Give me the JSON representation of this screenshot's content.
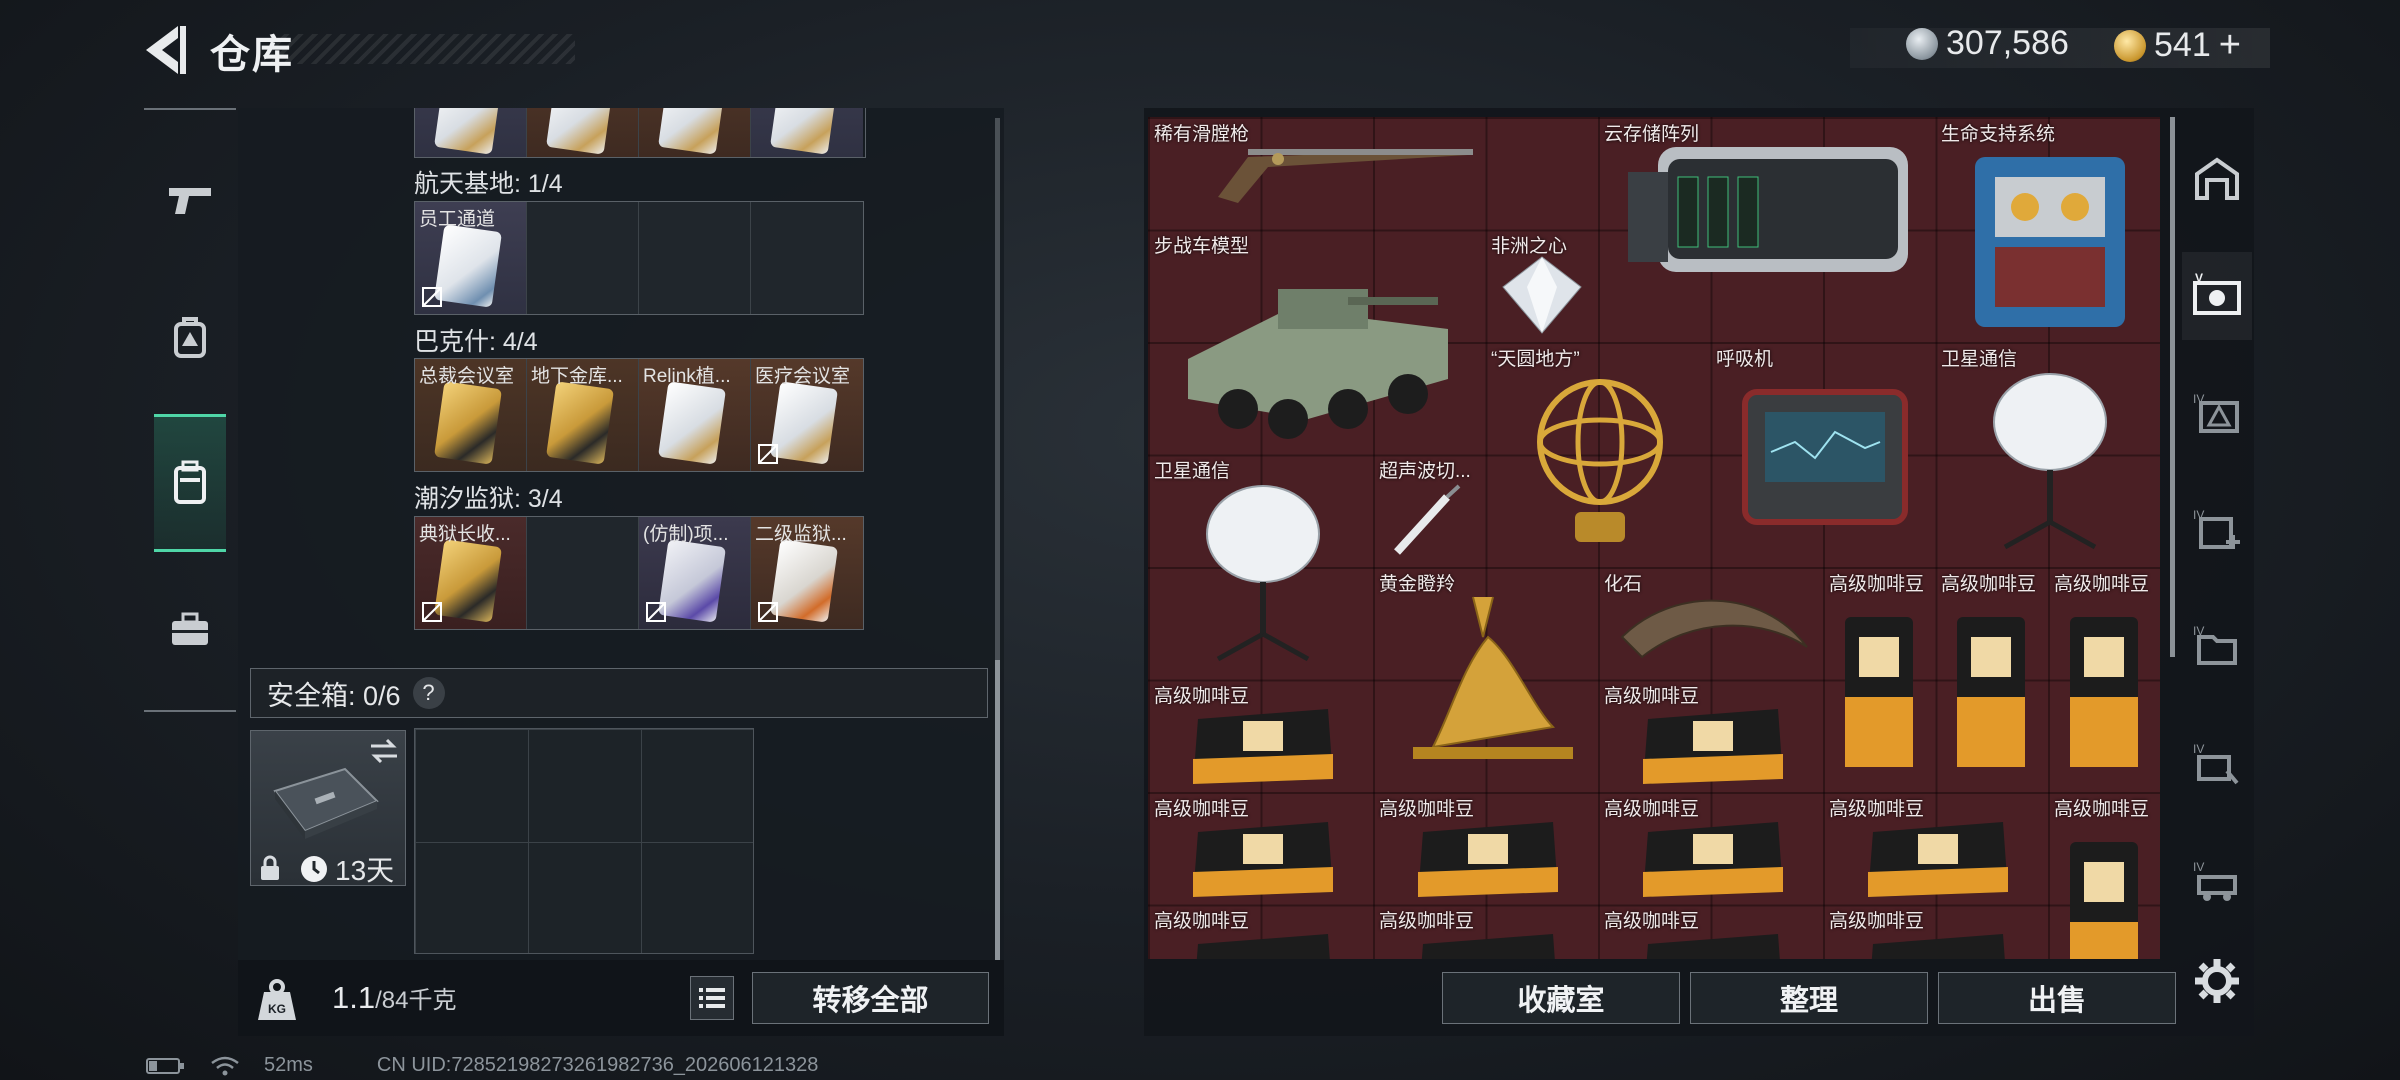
{
  "header": {
    "title": "仓库",
    "currency_silver": "307,586",
    "currency_gold": "541",
    "currency_plus": "+"
  },
  "left_panel": {
    "sections": [
      {
        "label": "航天基地: 1/4",
        "cells": [
          "员工通道",
          "",
          "",
          ""
        ]
      },
      {
        "label": "巴克什: 4/4",
        "cells": [
          "总裁会议室",
          "地下金库...",
          "Relink植...",
          "医疗会议室"
        ]
      },
      {
        "label": "潮汐监狱: 3/4",
        "cells": [
          "典狱长收...",
          "",
          "(仿制)项...",
          "二级监狱..."
        ]
      }
    ],
    "safebox_label": "安全箱: 0/6",
    "safebox_help": "?",
    "safebox_timer": "13天",
    "weight_value": "1.1",
    "weight_max": "/84千克",
    "transfer_all": "转移全部"
  },
  "items": [
    {
      "label": "稀有滑膛枪"
    },
    {
      "label": "云存储阵列"
    },
    {
      "label": "生命支持系统"
    },
    {
      "label": "步战车模型"
    },
    {
      "label": "非洲之心"
    },
    {
      "label": "“天圆地方”"
    },
    {
      "label": "呼吸机"
    },
    {
      "label": "卫星通信"
    },
    {
      "label": "卫星通信"
    },
    {
      "label": "超声波切..."
    },
    {
      "label": "黄金瞪羚"
    },
    {
      "label": "化石"
    },
    {
      "label": "高级咖啡豆"
    }
  ],
  "actions": {
    "collect": "收藏室",
    "sort": "整理",
    "sell": "出售"
  },
  "status": {
    "ping": "52ms",
    "uid": "CN UID:72852198273261982736_202606121328"
  },
  "colors": {
    "accent_green": "#4fd6a7",
    "grid_red": "#4a1f24"
  }
}
